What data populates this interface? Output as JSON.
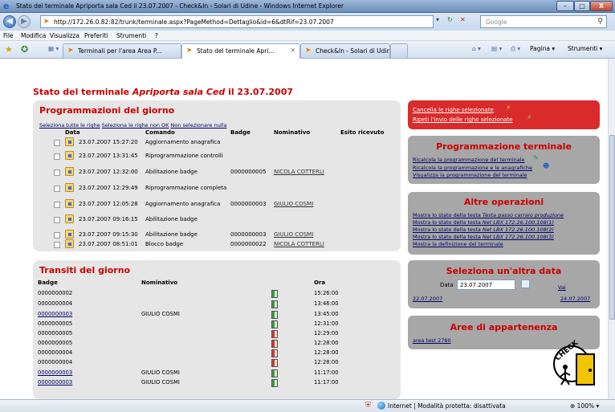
{
  "window": {
    "title": "Stato del terminale Apriporta sala Ced il 23.07.2007 - Check&In - Solari di Udine - Windows Internet Explorer",
    "minimize": "–",
    "maximize": "□",
    "close": "X"
  },
  "address": {
    "url": "http://172.26.0.82:82/trunk/terminale.aspx?PageMethod=Dettaglio&id=6&dtRif=23.07.2007",
    "search_placeholder": "Google"
  },
  "menu": [
    "File",
    "Modifica",
    "Visualizza",
    "Preferiti",
    "Strumenti",
    "?"
  ],
  "tabs": [
    {
      "label": "Terminali per l'area Area P..."
    },
    {
      "label": "Stato del terminale Apri..."
    },
    {
      "label": "Check&In - Solari di Udine"
    }
  ],
  "toolbar": {
    "page": "Pagina ▾",
    "tools": "Strumenti ▾"
  },
  "page_title": {
    "prefix": "Stato del terminale ",
    "name": "Apriporta sala Ced",
    "suffix": " il 23.07.2007"
  },
  "programmazioni": {
    "title": "Programmazioni del giorno",
    "select_all": "Seleziona tutte le righe",
    "select_not_ok": "Seleziona le righe non OK",
    "select_none": "Non selezionare nulla",
    "headers": {
      "data": "Data",
      "comando": "Comando",
      "badge": "Badge",
      "nominativo": "Nominativo",
      "esito": "Esito ricevuto"
    },
    "rows": [
      {
        "data": "23.07.2007 15:27:20",
        "comando": "Aggiornamento anagrafica",
        "badge": "",
        "nominativo": ""
      },
      {
        "data": "23.07.2007 13:31:45",
        "comando": "Riprogrammazione controlli",
        "badge": "",
        "nominativo": ""
      },
      {
        "data": "23.07.2007 12:32:00",
        "comando": "Abilitazione badge",
        "badge": "0000000005",
        "nominativo": "NICOLA COTTERLI"
      },
      {
        "data": "23.07.2007 12:29:49",
        "comando": "Riprogrammazione completa",
        "badge": "",
        "nominativo": ""
      },
      {
        "data": "23.07.2007 12:05:28",
        "comando": "Aggiornamento anagrafica",
        "badge": "0000000003",
        "nominativo": "GIULIO COSMI"
      },
      {
        "data": "23.07.2007 09:16:15",
        "comando": "Abilitazione badge",
        "badge": "",
        "nominativo": ""
      },
      {
        "data": "23.07.2007 09:15:30",
        "comando": "Abilitazione badge",
        "badge": "0000000003",
        "nominativo": "GIULIO COSMI"
      },
      {
        "data": "23.07.2007 08:51:01",
        "comando": "Blocco badge",
        "badge": "0000000022",
        "nominativo": "NICOLA COTTERLI"
      }
    ]
  },
  "transiti": {
    "title": "Transiti del giorno",
    "headers": {
      "badge": "Badge",
      "nominativo": "Nominativo",
      "ora": "Ora"
    },
    "rows": [
      {
        "badge": "0000000002",
        "nominativo": "",
        "dir": "in",
        "ora": "15:26:00",
        "link": false
      },
      {
        "badge": "0000000004",
        "nominativo": "",
        "dir": "in",
        "ora": "13:46:00",
        "link": false
      },
      {
        "badge": "0000000003",
        "nominativo": "GIULIO COSMI",
        "dir": "in",
        "ora": "13:45:00",
        "link": true
      },
      {
        "badge": "0000000005",
        "nominativo": "",
        "dir": "in",
        "ora": "12:31:00",
        "link": false
      },
      {
        "badge": "0000000005",
        "nominativo": "",
        "dir": "out",
        "ora": "12:29:00",
        "link": false
      },
      {
        "badge": "0000000005",
        "nominativo": "",
        "dir": "out",
        "ora": "12:28:00",
        "link": false
      },
      {
        "badge": "0000000004",
        "nominativo": "",
        "dir": "out",
        "ora": "12:28:00",
        "link": false
      },
      {
        "badge": "0000000004",
        "nominativo": "",
        "dir": "out",
        "ora": "12:28:00",
        "link": false
      },
      {
        "badge": "0000000003",
        "nominativo": "GIULIO COSMI",
        "dir": "in",
        "ora": "11:17:00",
        "link": true
      },
      {
        "badge": "0000000003",
        "nominativo": "GIULIO COSMI",
        "dir": "in",
        "ora": "11:17:00",
        "link": true
      }
    ]
  },
  "actions": {
    "cancel": "Cancella le righe selezionate",
    "repeat": "Ripeti l'invio delle righe selezionate"
  },
  "programmazione_terminale": {
    "title": "Programmazione terminale",
    "links": [
      "Ricalcola la programmazione del terminale",
      "Ricalcola la programmazione e le anagrafiche",
      "Visualizza la programmazione del terminale"
    ]
  },
  "altre_operazioni": {
    "title": "Altre operazioni",
    "links": [
      {
        "prefix": "Mostra lo stato della testa ",
        "em": "Testa passo carraio produzione"
      },
      {
        "prefix": "Mostra lo stato della testa ",
        "em": "Net LBX 172.26.100.108(1)"
      },
      {
        "prefix": "Mostra lo stato della testa ",
        "em": "Net LBX 172.26.100.108(2)"
      },
      {
        "prefix": "Mostra lo stato della testa ",
        "em": "Net LBX 172.26.100.108(3)"
      },
      {
        "prefix": "Mostra la definizione del terminale",
        "em": ""
      }
    ]
  },
  "seleziona_data": {
    "title": "Seleziona un'altra data",
    "label": "Data",
    "value": "23.07.2007",
    "go": "Vai",
    "prev": "22.07.2007",
    "next": "24.07.2007"
  },
  "aree": {
    "title": "Aree di appartenenza",
    "link": "area test 2780"
  },
  "statusbar": {
    "text": "Internet | Modalità protetta: disattivata",
    "zoom": "100%"
  },
  "colors": {
    "accent": "#cc0000",
    "panel": "#e6e6e6",
    "panel_dark": "#a7a7a7",
    "action": "#d92b2b"
  }
}
